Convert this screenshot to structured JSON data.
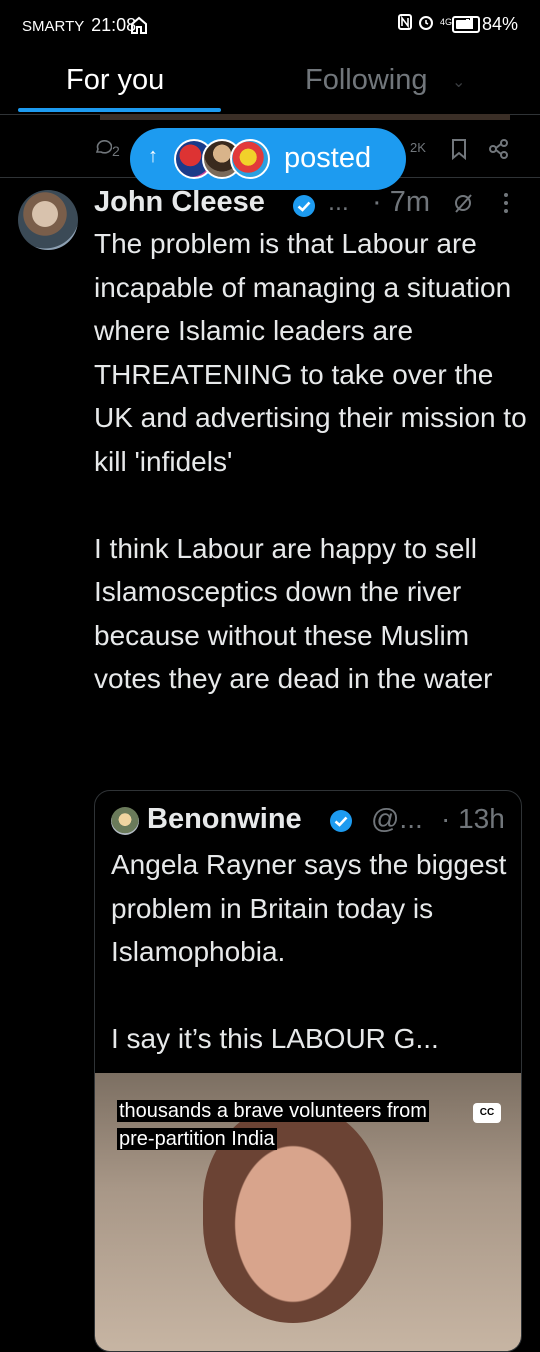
{
  "status_bar": {
    "carrier": "SMARTY",
    "time": "21:08",
    "network": "4G",
    "battery": "84%",
    "battery_level": 0.84
  },
  "tabs": [
    {
      "label": "For you",
      "active": true
    },
    {
      "label": "Following",
      "active": false
    }
  ],
  "prev_post": {
    "comments": "2",
    "views": "2K"
  },
  "posted_pill": {
    "label": "posted"
  },
  "post": {
    "author": "John Cleese",
    "handle": "...",
    "time": "· 7m",
    "body": "The  problem is that Labour are  incapable of managing a situation where Islamic leaders are THREATENING to take over the UK and advertising their mission to kill 'infidels'\n\nI think Labour are happy to sell Islamosceptics down the river because without these Muslim votes they are dead in the water"
  },
  "quote": {
    "author": "Benonwine",
    "handle": "@...",
    "time": "· 13h",
    "body": "Angela Rayner says the biggest problem in Britain today  is Islamophobia.\n\nI say it’s this LABOUR G...",
    "caption_line1": "thousands a brave volunteers from",
    "caption_line2": "pre-partition India",
    "cc_label": "CC"
  },
  "colors": {
    "accent": "#1d9bf0",
    "background": "#000000",
    "text_primary": "#e7e9ea",
    "text_secondary": "#71767b",
    "divider": "#2f3336"
  },
  "icons": [
    "home-icon",
    "nfc-icon",
    "alarm-icon",
    "signal-icon",
    "battery-icon",
    "comment-icon",
    "bookmark-icon",
    "share-icon",
    "verified-icon",
    "grok-icon",
    "more-icon",
    "arrow-up-icon",
    "cc-icon"
  ]
}
